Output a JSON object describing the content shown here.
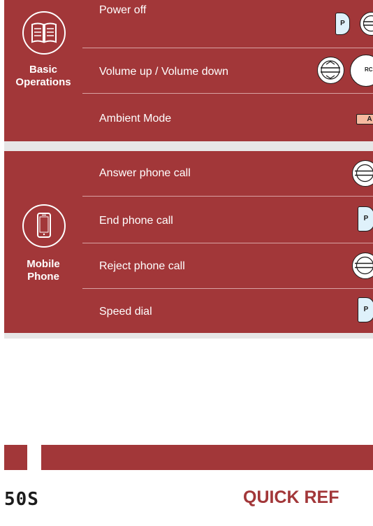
{
  "sections": [
    {
      "title_line1": "Basic",
      "title_line2": "Operations",
      "icon": "book-icon",
      "rows": [
        {
          "label": "Power off",
          "buttons": [
            "phone-button",
            "jog-dial"
          ]
        },
        {
          "label": "Volume up / Volume down",
          "buttons": [
            "jog-dial",
            "rc-button"
          ]
        },
        {
          "label": "Ambient Mode",
          "buttons": [
            "ambient-button"
          ]
        }
      ]
    },
    {
      "title_line1": "Mobile",
      "title_line2": "Phone",
      "icon": "smartphone-icon",
      "rows": [
        {
          "label": "Answer phone call",
          "buttons": [
            "jog-dial"
          ]
        },
        {
          "label": "End phone call",
          "buttons": [
            "phone-button"
          ]
        },
        {
          "label": "Reject phone call",
          "buttons": [
            "jog-dial"
          ]
        },
        {
          "label": "Speed dial",
          "buttons": [
            "phone-button"
          ]
        }
      ]
    }
  ],
  "button_glyphs": {
    "phone": "P",
    "ambient": "A",
    "rc": "RC"
  },
  "footer": {
    "logo": "50S",
    "title": "QUICK REF"
  },
  "colors": {
    "accent": "#a23739",
    "strip": "#e7e6e6",
    "phone_button": "#dff1fb",
    "ambient_button": "#f6b99f"
  }
}
